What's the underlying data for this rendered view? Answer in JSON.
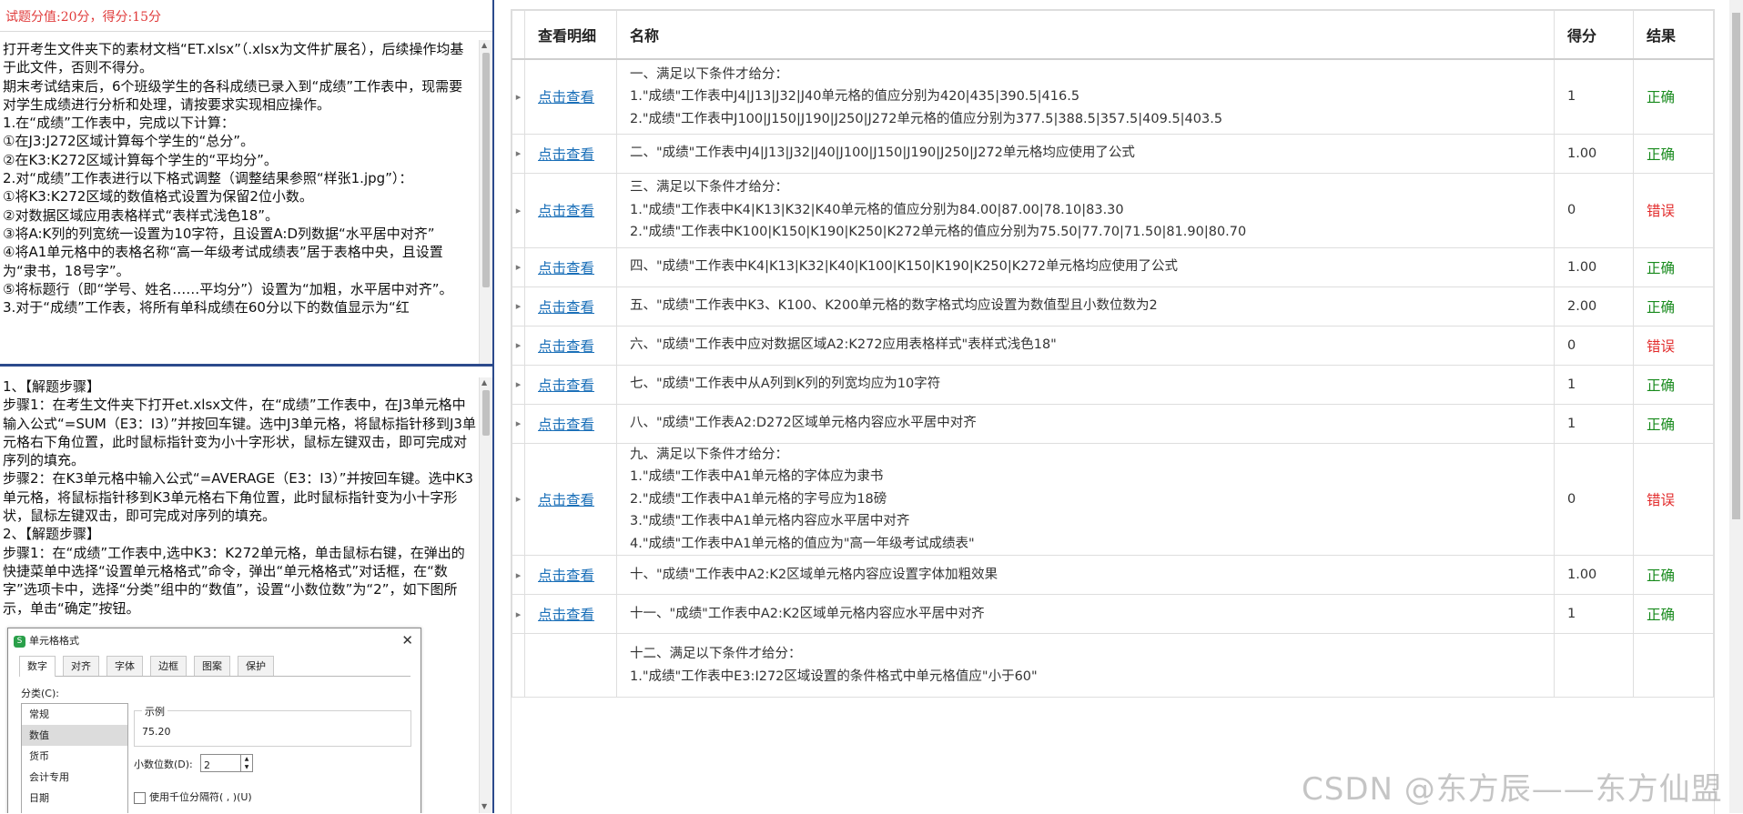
{
  "score_bar": {
    "text": "试题分值:20分，得分:15分"
  },
  "question_lines": [
    "打开考生文件夹下的素材文档“ET.xlsx”（.xlsx为文件扩展名），后续操作均基于此文件，否则不得分。",
    "期末考试结束后，6个班级学生的各科成绩已录入到“成绩”工作表中，现需要对学生成绩进行分析和处理，请按要求实现相应操作。",
    "1.在“成绩”工作表中，完成以下计算：",
    "①在J3:J272区域计算每个学生的“总分”。",
    "②在K3:K272区域计算每个学生的“平均分”。",
    "2.对“成绩”工作表进行以下格式调整（调整结果参照“样张1.jpg”）：",
    "①将K3:K272区域的数值格式设置为保留2位小数。",
    "②对数据区域应用表格样式“表样式浅色18”。",
    "③将A:K列的列宽统一设置为10字符，且设置A:D列数据“水平居中对齐”",
    "④将A1单元格中的表格名称“高一年级考试成绩表”居于表格中央，且设置为“隶书，18号字”。",
    "⑤将标题行（即“学号、姓名……平均分”）设置为“加粗，水平居中对齐”。",
    "3.对于“成绩”工作表，将所有单科成绩在60分以下的数值显示为“红"
  ],
  "answer_lines": [
    "1、【解题步骤】",
    "步骤1：在考生文件夹下打开et.xlsx文件，在“成绩”工作表中，在J3单元格中输入公式“=SUM（E3：I3）”并按回车键。选中J3单元格，将鼠标指针移到J3单元格右下角位置，此时鼠标指针变为小十字形状，鼠标左键双击，即可完成对序列的填充。",
    "步骤2：在K3单元格中输入公式“=AVERAGE（E3：I3）”并按回车键。选中K3单元格，将鼠标指针移到K3单元格右下角位置，此时鼠标指针变为小十字形状，鼠标左键双击，即可完成对序列的填充。",
    "2、【解题步骤】",
    "步骤1：在“成绩”工作表中,选中K3：K272单元格，单击鼠标右键，在弹出的快捷菜单中选择“设置单元格格式”命令，弹出“单元格格式”对话框，在“数字”选项卡中，选择“分类”组中的“数值”，设置“小数位数”为“2”，如下图所示，单击“确定”按钮。"
  ],
  "dialog": {
    "logo": "S",
    "title": "单元格格式",
    "close": "✕",
    "tabs": [
      "数字",
      "对齐",
      "字体",
      "边框",
      "图案",
      "保护"
    ],
    "category_label": "分类(C):",
    "categories": [
      "常规",
      "数值",
      "货币",
      "会计专用",
      "日期"
    ],
    "sample_label": "示例",
    "sample_value": "75.20",
    "decimal_label": "小数位数(D):",
    "decimal_value": "2",
    "thousands_label": "使用千位分隔符( , )(U)"
  },
  "table": {
    "headers": [
      "查看明细",
      "名称",
      "得分",
      "结果"
    ],
    "rows": [
      {
        "view": "点击查看",
        "name": [
          "一、满足以下条件才给分：",
          "1.\"成绩\"工作表中J4|J13|J32|J40单元格的值应分别为420|435|390.5|416.5",
          "2.\"成绩\"工作表中J100|J150|J190|J250|J272单元格的值应分别为377.5|388.5|357.5|409.5|403.5"
        ],
        "score": "1",
        "result": "正确",
        "ok": true
      },
      {
        "view": "点击查看",
        "name": [
          "二、\"成绩\"工作表中J4|J13|J32|J40|J100|J150|J190|J250|J272单元格均应使用了公式"
        ],
        "score": "1.00",
        "result": "正确",
        "ok": true
      },
      {
        "view": "点击查看",
        "name": [
          "三、满足以下条件才给分：",
          "1.\"成绩\"工作表中K4|K13|K32|K40单元格的值应分别为84.00|87.00|78.10|83.30",
          "2.\"成绩\"工作表中K100|K150|K190|K250|K272单元格的值应分别为75.50|77.70|71.50|81.90|80.70"
        ],
        "score": "0",
        "result": "错误",
        "ok": false
      },
      {
        "view": "点击查看",
        "name": [
          "四、\"成绩\"工作表中K4|K13|K32|K40|K100|K150|K190|K250|K272单元格均应使用了公式"
        ],
        "score": "1.00",
        "result": "正确",
        "ok": true
      },
      {
        "view": "点击查看",
        "name": [
          "五、\"成绩\"工作表中K3、K100、K200单元格的数字格式均应设置为数值型且小数位数为2"
        ],
        "score": "2.00",
        "result": "正确",
        "ok": true
      },
      {
        "view": "点击查看",
        "name": [
          "六、\"成绩\"工作表中应对数据区域A2:K272应用表格样式\"表样式浅色18\""
        ],
        "score": "0",
        "result": "错误",
        "ok": false
      },
      {
        "view": "点击查看",
        "name": [
          "七、\"成绩\"工作表中从A列到K列的列宽均应为10字符"
        ],
        "score": "1",
        "result": "正确",
        "ok": true
      },
      {
        "view": "点击查看",
        "name": [
          "八、\"成绩\"工作表A2:D272区域单元格内容应水平居中对齐"
        ],
        "score": "1",
        "result": "正确",
        "ok": true
      },
      {
        "view": "点击查看",
        "name": [
          "九、满足以下条件才给分：",
          "1.\"成绩\"工作表中A1单元格的字体应为隶书",
          "2.\"成绩\"工作表中A1单元格的字号应为18磅",
          "3.\"成绩\"工作表中A1单元格内容应水平居中对齐",
          "4.\"成绩\"工作表中A1单元格的值应为\"高一年级考试成绩表\""
        ],
        "score": "0",
        "result": "错误",
        "ok": false
      },
      {
        "view": "点击查看",
        "name": [
          "十、\"成绩\"工作表中A2:K2区域单元格内容应设置字体加粗效果"
        ],
        "score": "1.00",
        "result": "正确",
        "ok": true
      },
      {
        "view": "点击查看",
        "name": [
          "十一、\"成绩\"工作表中A2:K2区域单元格内容应水平居中对齐"
        ],
        "score": "1",
        "result": "正确",
        "ok": true
      },
      {
        "view": "",
        "name": [
          "十二、满足以下条件才给分：",
          "1.\"成绩\"工作表中E3:I272区域设置的条件格式中单元格值应\"小于60\""
        ],
        "score": "",
        "result": "",
        "ok": true
      }
    ]
  },
  "colors": {
    "ok": "#178a1c",
    "bad": "#e22b2b",
    "link": "#1a6fb8",
    "score_bar": "#e03c3c",
    "divider": "#2c4a8c"
  },
  "icons": {
    "expand": "▸"
  },
  "watermark": "CSDN @东方辰——东方仙盟"
}
